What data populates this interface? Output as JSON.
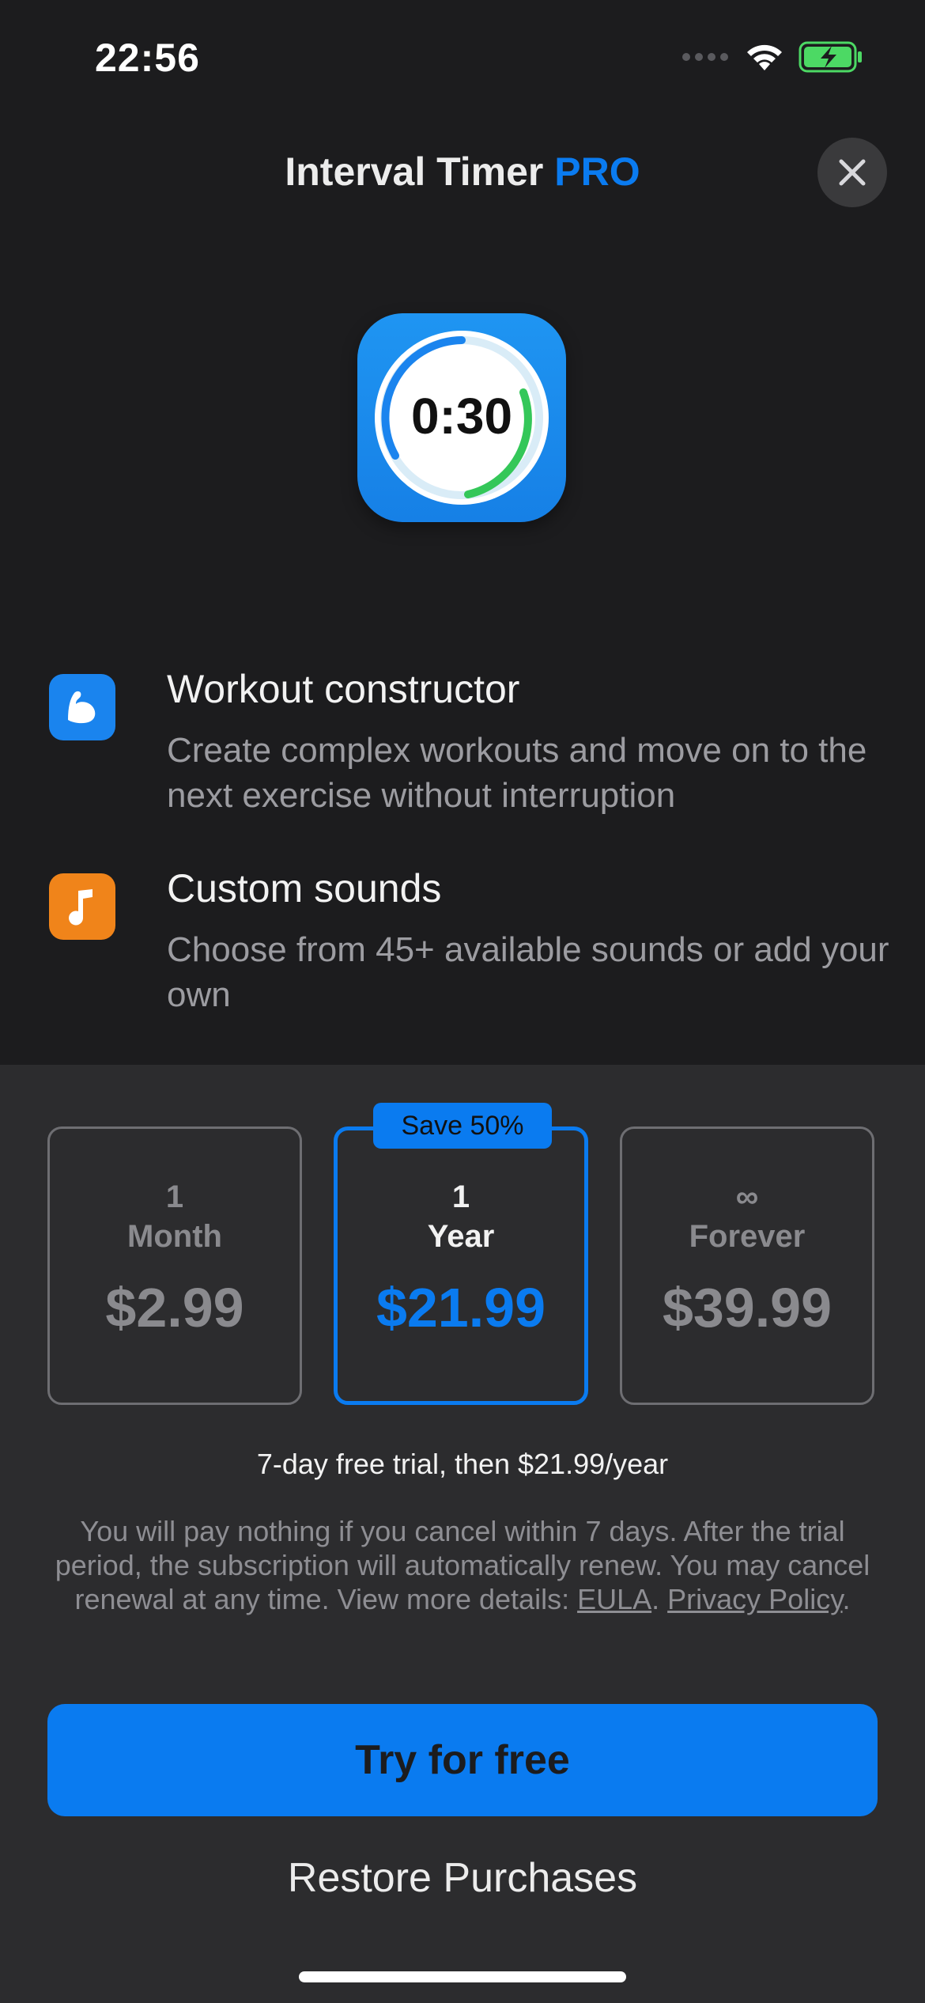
{
  "status_bar": {
    "time": "22:56"
  },
  "header": {
    "title": "Interval Timer",
    "title_highlight": "PRO"
  },
  "app_icon": {
    "timer_text": "0:30"
  },
  "features": [
    {
      "icon": "muscle-icon",
      "icon_color": "#1a84ee",
      "title": "Workout constructor",
      "description": "Create complex workouts and move on to the next exercise without interruption"
    },
    {
      "icon": "music-note-icon",
      "icon_color": "#f0841a",
      "title": "Custom sounds",
      "description": "Choose from 45+ available sounds or add your own"
    }
  ],
  "plans": [
    {
      "number": "1",
      "unit": "Month",
      "price": "$2.99",
      "selected": false
    },
    {
      "number": "1",
      "unit": "Year",
      "price": "$21.99",
      "selected": true,
      "badge": "Save 50%"
    },
    {
      "number": "∞",
      "unit": "Forever",
      "price": "$39.99",
      "selected": false
    }
  ],
  "trial_text": "7-day free trial, then $21.99/year",
  "legal": {
    "text": "You will pay nothing if you cancel within 7 days. After the trial period, the subscription will automatically renew. You may cancel renewal at any time. View more details: ",
    "eula_link": "EULA",
    "separator": ". ",
    "privacy_link": "Privacy Policy",
    "end": "."
  },
  "cta_label": "Try for free",
  "restore_label": "Restore Purchases",
  "colors": {
    "accent": "#0a7bf0",
    "background": "#1c1c1e",
    "panel": "#2c2c2e"
  }
}
